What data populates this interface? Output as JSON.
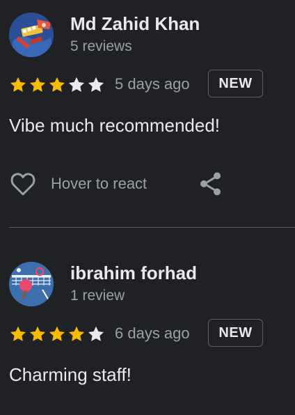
{
  "colors": {
    "background": "#202124",
    "star_filled": "#f6bb06",
    "star_empty": "#e8eaed",
    "text_primary": "#e8eaed",
    "text_secondary": "#9aa0a6",
    "divider": "#5f6368"
  },
  "reviews": [
    {
      "reviewer_name": "Md Zahid Khan",
      "review_count": "5 reviews",
      "rating": 3,
      "max_rating": 5,
      "time_ago": "5 days ago",
      "badge": "NEW",
      "text": "Vibe much recommended!",
      "react_label": "Hover to react",
      "react_icon": "heart-outline-icon",
      "share_icon": "share-icon",
      "avatar_icon": "avatar-illustration-icon"
    },
    {
      "reviewer_name": "ibrahim forhad",
      "review_count": "1 review",
      "rating": 4,
      "max_rating": 5,
      "time_ago": "6 days ago",
      "badge": "NEW",
      "text": "Charming staff!",
      "avatar_icon": "ping-pong-avatar-icon"
    }
  ]
}
